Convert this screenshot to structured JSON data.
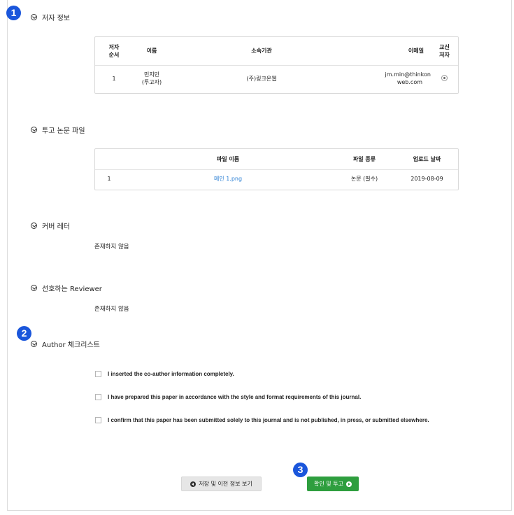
{
  "annotations": {
    "one": "1",
    "two": "2",
    "three": "3"
  },
  "sections": {
    "author_info": {
      "title": "저자 정보"
    },
    "submit_files": {
      "title": "투고 논문 파일"
    },
    "cover_letter": {
      "title": "커버 레터",
      "value": "존재하지 않음"
    },
    "preferred_reviewer": {
      "title": "선호하는 Reviewer",
      "value": "존재하지 않음"
    },
    "author_checklist": {
      "title": "Author 체크리스트"
    }
  },
  "author_table": {
    "headers": {
      "order_1": "저자",
      "order_2": "순서",
      "name": "이름",
      "affiliation": "소속기관",
      "email": "이메일",
      "corr_1": "교신",
      "corr_2": "저자"
    },
    "rows": [
      {
        "order": "1",
        "name_1": "민지민",
        "name_2": "(투고자)",
        "affiliation": "(주)링크온웹",
        "email_1": "jm.min@thinkon",
        "email_2": "web.com",
        "corresponding": true
      }
    ]
  },
  "file_table": {
    "headers": {
      "name": "파일 이름",
      "type": "파일 종류",
      "date": "업로드 날짜"
    },
    "rows": [
      {
        "no": "1",
        "name": "메인 1.png",
        "type": "논문 (필수)",
        "date": "2019-08-09"
      }
    ]
  },
  "checklist": [
    {
      "label": "I inserted the co-author information completely.",
      "checked": false
    },
    {
      "label": "I have prepared this paper in accordance with the style and format requirements of this journal.",
      "checked": false
    },
    {
      "label": "I confirm that this paper has been submitted solely to this journal and is not published, in press, or submitted elsewhere.",
      "checked": false
    }
  ],
  "buttons": {
    "save_prev": "저장 및 이전 정보 보기",
    "confirm_submit": "확인 및 투고"
  },
  "colors": {
    "badge": "#1a56db",
    "submit_button": "#2e9e3e",
    "file_link": "#2a7fd4"
  }
}
